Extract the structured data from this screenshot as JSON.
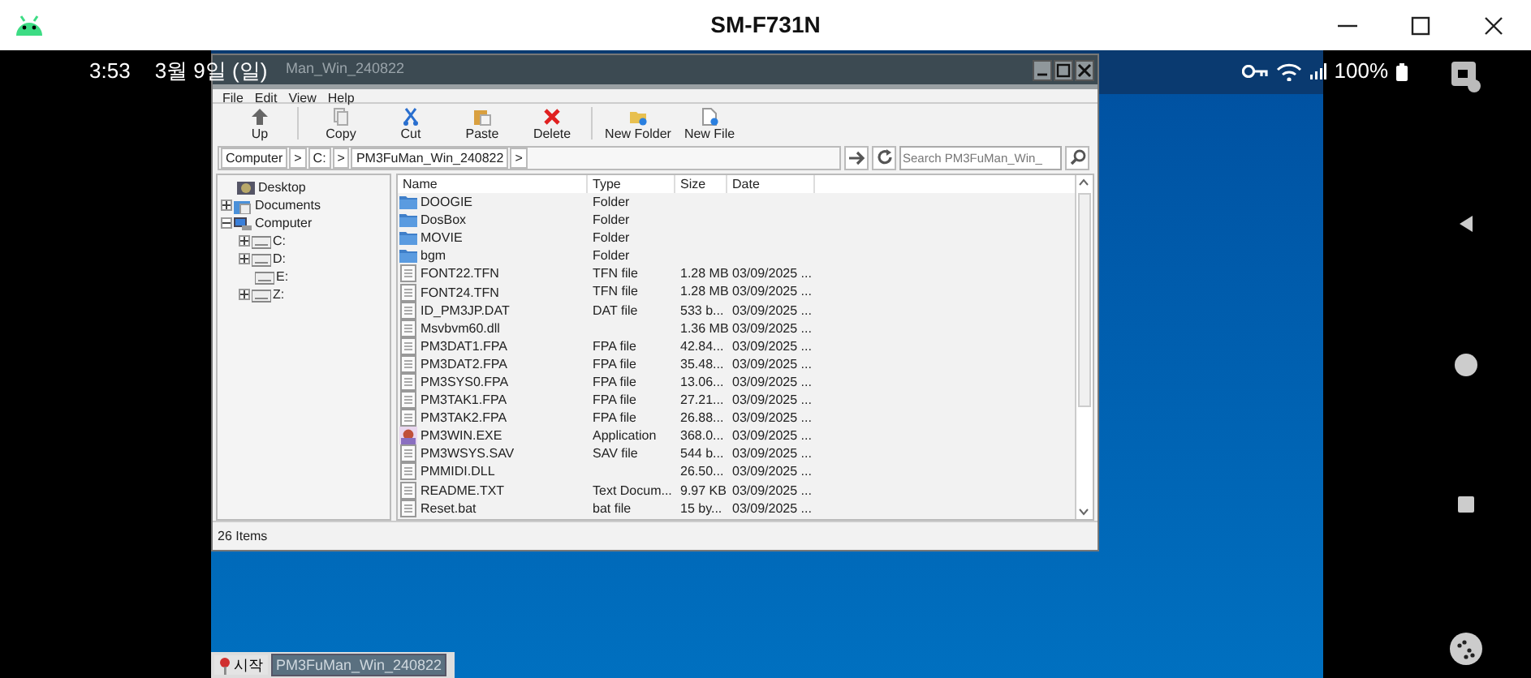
{
  "device_window": {
    "title": "SM-F731N"
  },
  "status_bar": {
    "time": "3:53",
    "date": "3월 9일 (일)",
    "battery": "100%"
  },
  "file_manager": {
    "title": "Man_Win_240822",
    "menu": [
      "File",
      "Edit",
      "View",
      "Help"
    ],
    "toolbar": [
      {
        "kind": "up",
        "label": "Up"
      },
      {
        "kind": "copy",
        "label": "Copy"
      },
      {
        "kind": "cut",
        "label": "Cut"
      },
      {
        "kind": "paste",
        "label": "Paste"
      },
      {
        "kind": "delete",
        "label": "Delete"
      },
      {
        "kind": "new_folder",
        "label": "New Folder"
      },
      {
        "kind": "new_file",
        "label": "New File"
      }
    ],
    "breadcrumb": [
      {
        "label": "Computer",
        "arrow": ">"
      },
      {
        "label": "C:",
        "arrow": ">"
      },
      {
        "label": "PM3FuMan_Win_240822",
        "arrow": ">"
      }
    ],
    "search": {
      "placeholder": "Search PM3FuMan_Win_"
    },
    "tree": [
      {
        "label": "Desktop",
        "kind": "desktop"
      },
      {
        "label": "Documents",
        "kind": "documents",
        "expanded": false
      },
      {
        "label": "Computer",
        "kind": "computer",
        "expanded": true,
        "children": [
          {
            "label": "C:",
            "kind": "drive",
            "expanded": false
          },
          {
            "label": "D:",
            "kind": "drive",
            "expanded": false
          },
          {
            "label": "E:",
            "kind": "drive"
          },
          {
            "label": "Z:",
            "kind": "drive",
            "expanded": false
          }
        ]
      }
    ],
    "columns": [
      "Name",
      "Type",
      "Size",
      "Date"
    ],
    "rows": [
      {
        "kind": "folder",
        "name": "DOOGIE",
        "type": "Folder"
      },
      {
        "kind": "folder",
        "name": "DosBox",
        "type": "Folder"
      },
      {
        "kind": "folder",
        "name": "MOVIE",
        "type": "Folder"
      },
      {
        "kind": "folder",
        "name": "bgm",
        "type": "Folder"
      },
      {
        "kind": "file",
        "name": "FONT22.TFN",
        "type": "TFN file",
        "size": "1.28 MB",
        "date": "03/09/2025 ..."
      },
      {
        "kind": "file",
        "name": "FONT24.TFN",
        "type": "TFN file",
        "size": "1.28 MB",
        "date": "03/09/2025 ..."
      },
      {
        "kind": "file",
        "name": "ID_PM3JP.DAT",
        "type": "DAT file",
        "size": "533 b...",
        "date": "03/09/2025 ..."
      },
      {
        "kind": "file",
        "name": "Msvbvm60.dll",
        "size": "1.36 MB",
        "date": "03/09/2025 ..."
      },
      {
        "kind": "file",
        "name": "PM3DAT1.FPA",
        "type": "FPA file",
        "size": "42.84...",
        "date": "03/09/2025 ..."
      },
      {
        "kind": "file",
        "name": "PM3DAT2.FPA",
        "type": "FPA file",
        "size": "35.48...",
        "date": "03/09/2025 ..."
      },
      {
        "kind": "file",
        "name": "PM3SYS0.FPA",
        "type": "FPA file",
        "size": "13.06...",
        "date": "03/09/2025 ..."
      },
      {
        "kind": "file",
        "name": "PM3TAK1.FPA",
        "type": "FPA file",
        "size": "27.21...",
        "date": "03/09/2025 ..."
      },
      {
        "kind": "file",
        "name": "PM3TAK2.FPA",
        "type": "FPA file",
        "size": "26.88...",
        "date": "03/09/2025 ..."
      },
      {
        "kind": "app",
        "name": "PM3WIN.EXE",
        "type": "Application",
        "size": "368.0...",
        "date": "03/09/2025 ..."
      },
      {
        "kind": "file",
        "name": "PM3WSYS.SAV",
        "type": "SAV file",
        "size": "544 b...",
        "date": "03/09/2025 ..."
      },
      {
        "kind": "file",
        "name": "PMMIDI.DLL",
        "size": "26.50...",
        "date": "03/09/2025 ..."
      },
      {
        "kind": "file",
        "name": "README.TXT",
        "type": "Text Docum...",
        "size": "9.97 KB",
        "date": "03/09/2025 ..."
      },
      {
        "kind": "file",
        "name": "Reset.bat",
        "type": "bat file",
        "size": "15 by...",
        "date": "03/09/2025 ..."
      }
    ],
    "status": "26 Items"
  },
  "taskbar": {
    "start": "시작",
    "tasks": [
      "PM3FuMan_Win_240822"
    ]
  }
}
